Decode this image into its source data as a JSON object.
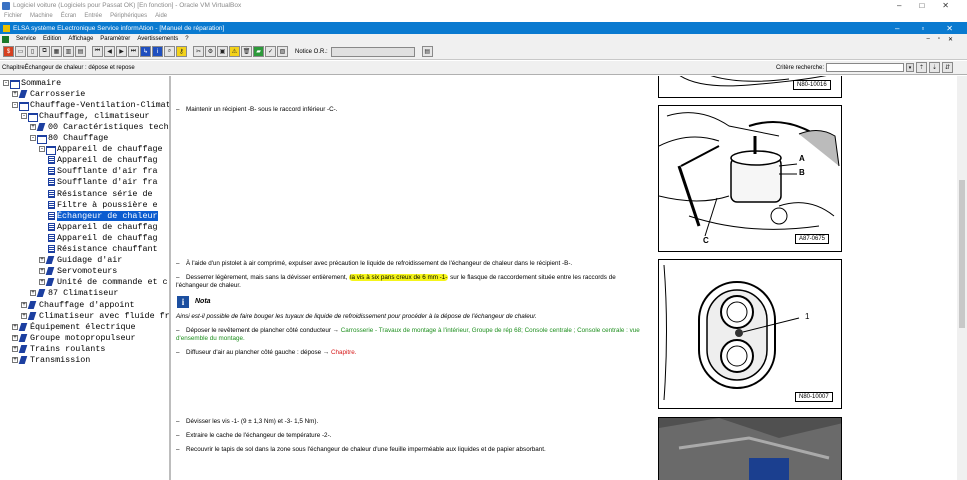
{
  "vbox": {
    "title": "Logiciel voiture (Logiciels pour Passat OK) [En fonction] - Oracle VM VirtualBox",
    "menu": [
      "Fichier",
      "Machine",
      "Écran",
      "Entrée",
      "Périphériques",
      "Aide"
    ],
    "min": "–",
    "max": "□",
    "close": "✕"
  },
  "app": {
    "title": "ELSA système ELectronique Service informAtion - [Manuel de réparation]",
    "menu": [
      "Service",
      "Edition",
      "Affichage",
      "Paramètrer",
      "Avertissements",
      "?"
    ],
    "win_controls": [
      "–",
      "▫",
      "✕"
    ],
    "inner_controls": [
      "–",
      "▫",
      "✕"
    ],
    "notice_label": "Notice O.R.:",
    "notice_value": ""
  },
  "chapter_bar": {
    "text": "ChapitreÉchangeur de chaleur : dépose et repose",
    "criteria_label": "Critère recherche:",
    "criteria_value": ""
  },
  "tree": [
    {
      "label": "Sommaire",
      "level": 0,
      "icon": "book-open",
      "exp": "-"
    },
    {
      "label": "Carrosserie",
      "level": 1,
      "icon": "book-closed",
      "exp": "+"
    },
    {
      "label": "Chauffage-Ventilation-Climat",
      "level": 1,
      "icon": "book-open",
      "exp": "-"
    },
    {
      "label": "Chauffage, climatiseur",
      "level": 2,
      "icon": "book-open",
      "exp": "-"
    },
    {
      "label": "00 Caractéristiques tech",
      "level": 3,
      "icon": "book-closed",
      "exp": "+"
    },
    {
      "label": "80 Chauffage",
      "level": 3,
      "icon": "book-open",
      "exp": "-"
    },
    {
      "label": "Appareil de chauffage",
      "level": 4,
      "icon": "book-open",
      "exp": "-"
    },
    {
      "label": "Appareil de chauffag",
      "level": 5,
      "icon": "doc",
      "exp": ""
    },
    {
      "label": "Soufflante d'air fra",
      "level": 5,
      "icon": "doc",
      "exp": ""
    },
    {
      "label": "Soufflante d'air fra",
      "level": 5,
      "icon": "doc",
      "exp": ""
    },
    {
      "label": "Résistance série de",
      "level": 5,
      "icon": "doc",
      "exp": ""
    },
    {
      "label": "Filtre à poussière e",
      "level": 5,
      "icon": "doc",
      "exp": ""
    },
    {
      "label": "Échangeur de chaleur",
      "level": 5,
      "icon": "doc",
      "exp": "",
      "selected": true
    },
    {
      "label": "Appareil de chauffag",
      "level": 5,
      "icon": "doc",
      "exp": ""
    },
    {
      "label": "Appareil de chauffag",
      "level": 5,
      "icon": "doc",
      "exp": ""
    },
    {
      "label": "Résistance chauffant",
      "level": 5,
      "icon": "doc",
      "exp": ""
    },
    {
      "label": "Guidage d'air",
      "level": 4,
      "icon": "book-closed",
      "exp": "+"
    },
    {
      "label": "Servomoteurs",
      "level": 4,
      "icon": "book-closed",
      "exp": "+"
    },
    {
      "label": "Unité de commande et c",
      "level": 4,
      "icon": "book-closed",
      "exp": "+"
    },
    {
      "label": "87 Climatiseur",
      "level": 3,
      "icon": "book-closed",
      "exp": "+"
    },
    {
      "label": "Chauffage d'appoint",
      "level": 2,
      "icon": "book-closed",
      "exp": "+"
    },
    {
      "label": "Climatiseur avec fluide fr",
      "level": 2,
      "icon": "book-closed",
      "exp": "+"
    },
    {
      "label": "Équipement électrique",
      "level": 1,
      "icon": "book-closed",
      "exp": "+"
    },
    {
      "label": "Groupe motopropulseur",
      "level": 1,
      "icon": "book-closed",
      "exp": "+"
    },
    {
      "label": "Trains roulants",
      "level": 1,
      "icon": "book-closed",
      "exp": "+"
    },
    {
      "label": "Transmission",
      "level": 1,
      "icon": "book-closed",
      "exp": "+"
    }
  ],
  "content": {
    "p1": "Maintenir un récipient -B- sous le raccord inférieur -C-.",
    "p2": "À l'aide d'un pistolet à air comprimé, expulser avec précaution le liquide de refroidissement de l'échangeur de chaleur dans le récipient -B-.",
    "p3_a": "Desserrer légèrement, mais sans la dévisser entièrement,",
    "p3_hl": "la vis à six pans creux de 6 mm -1-",
    "p3_b": "sur le flasque de raccordement située entre les raccords de l'échangeur de chaleur.",
    "note_icon": "i",
    "note_title": "Nota",
    "note_body": "Ainsi est-il possible de faire bouger les tuyaux de liquide de refroidissement pour procéder à la dépose de l'échangeur de chaleur.",
    "p4_a": "Déposer le revêtement de plancher côté conducteur →",
    "p4_link": "Carrosserie - Travaux de montage à l'intérieur, Groupe de rép 68; Console centrale ; Console centrale : vue d'ensemble du montage.",
    "p5_a": "Diffuseur d'air au plancher côté gauche : dépose →",
    "p5_link": "Chapitre.",
    "p6": "Dévisser les vis -1- (9 ± 1,3 Nm) et -3- 1,5 Nm).",
    "p7": "Extraire le cache de l'échangeur de température -2-.",
    "p8": "Recouvrir le tapis de sol dans la zone sous l'échangeur de chaleur d'une feuille imperméable aux liquides et de papier absorbant.",
    "dash": "–"
  },
  "figures": {
    "fig1_label": "N80-10016",
    "fig2_label": "A87-0675",
    "fig2_b": "B",
    "fig2_a": "A",
    "fig2_c": "C",
    "fig3_label": "N80-10007",
    "fig3_1": "1"
  }
}
